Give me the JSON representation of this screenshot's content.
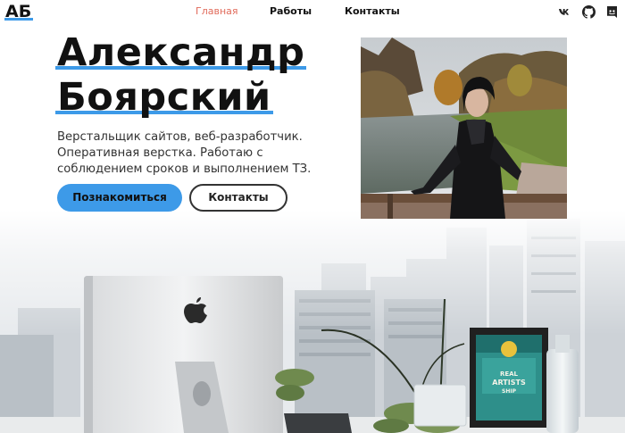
{
  "header": {
    "logo": "АБ",
    "nav": [
      "Главная",
      "Работы",
      "Контакты"
    ],
    "social": [
      "vk-icon",
      "github-icon",
      "discord-icon"
    ],
    "active_color": "#e16a5a"
  },
  "hero": {
    "title_line1": "Александр",
    "title_line2": "Боярский",
    "desc_line1": "Верстальщик сайтов, веб-разработчик.",
    "desc_line2": "Оперативная верстка. Работаю с",
    "desc_line3": "соблюдением сроков и выполнением ТЗ.",
    "cta_primary": "Познакомиться",
    "cta_secondary": "Контакты",
    "accent": "#3d9ae8"
  },
  "scene": {
    "poster_line1": "REAL",
    "poster_line2": "ARTISTS",
    "poster_line3": "SHIP"
  }
}
